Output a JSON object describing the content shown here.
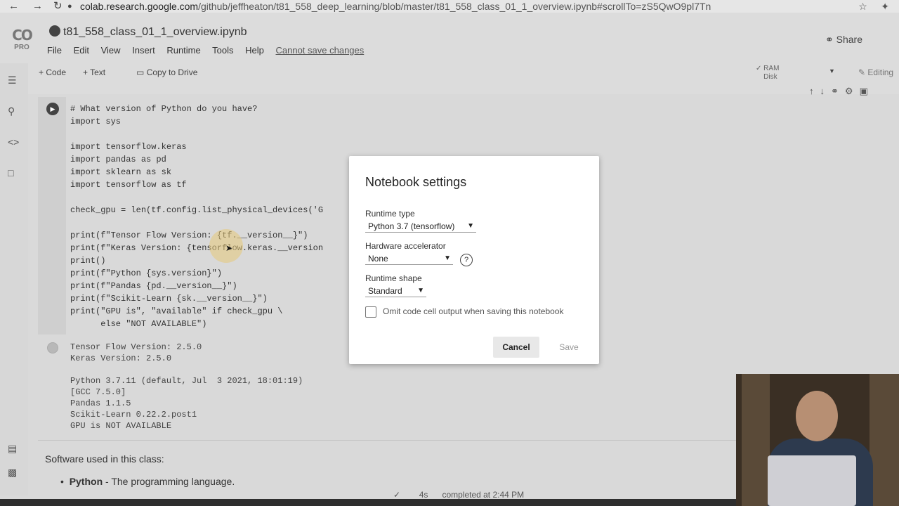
{
  "browser": {
    "url_domain": "colab.research.google.com",
    "url_path": "/github/jeffheaton/t81_558_deep_learning/blob/master/t81_558_class_01_1_overview.ipynb#scrollTo=zS5QwO9pl7Tn"
  },
  "header": {
    "logo_pro": "PRO",
    "title": "t81_558_class_01_1_overview.ipynb",
    "menu": [
      "File",
      "Edit",
      "View",
      "Insert",
      "Runtime",
      "Tools",
      "Help"
    ],
    "warning": "Cannot save changes",
    "share_label": "Share"
  },
  "toolbar": {
    "add_code": "+ Code",
    "add_text": "+ Text",
    "copy_to_drive": "Copy to Drive",
    "ram_label": "RAM",
    "disk_label": "Disk",
    "editing_label": "Editing"
  },
  "code_lines": [
    "# What version of Python do you have?",
    "import sys",
    "",
    "import tensorflow.keras",
    "import pandas as pd",
    "import sklearn as sk",
    "import tensorflow as tf",
    "",
    "check_gpu = len(tf.config.list_physical_devices('G",
    "",
    "print(f\"Tensor Flow Version: {tf.__version__}\")",
    "print(f\"Keras Version: {tensorflow.keras.__version",
    "print()",
    "print(f\"Python {sys.version}\")",
    "print(f\"Pandas {pd.__version__}\")",
    "print(f\"Scikit-Learn {sk.__version__}\")",
    "print(\"GPU is\", \"available\" if check_gpu \\",
    "      else \"NOT AVAILABLE\")"
  ],
  "output_lines": [
    "Tensor Flow Version: 2.5.0",
    "Keras Version: 2.5.0",
    "",
    "Python 3.7.11 (default, Jul  3 2021, 18:01:19)",
    "[GCC 7.5.0]",
    "Pandas 1.1.5",
    "Scikit-Learn 0.22.2.post1",
    "GPU is NOT AVAILABLE"
  ],
  "markdown": {
    "heading": "Software used in this class:",
    "item_bold": "Python",
    "item_rest": " - The programming language."
  },
  "status": {
    "duration": "4s",
    "completed": "completed at 2:44 PM"
  },
  "dialog": {
    "title": "Notebook settings",
    "runtime_type_label": "Runtime type",
    "runtime_type_value": "Python 3.7 (tensorflow)",
    "hardware_label": "Hardware accelerator",
    "hardware_value": "None",
    "shape_label": "Runtime shape",
    "shape_value": "Standard",
    "omit_label": "Omit code cell output when saving this notebook",
    "omit_checked": false,
    "cancel_label": "Cancel",
    "save_label": "Save"
  }
}
